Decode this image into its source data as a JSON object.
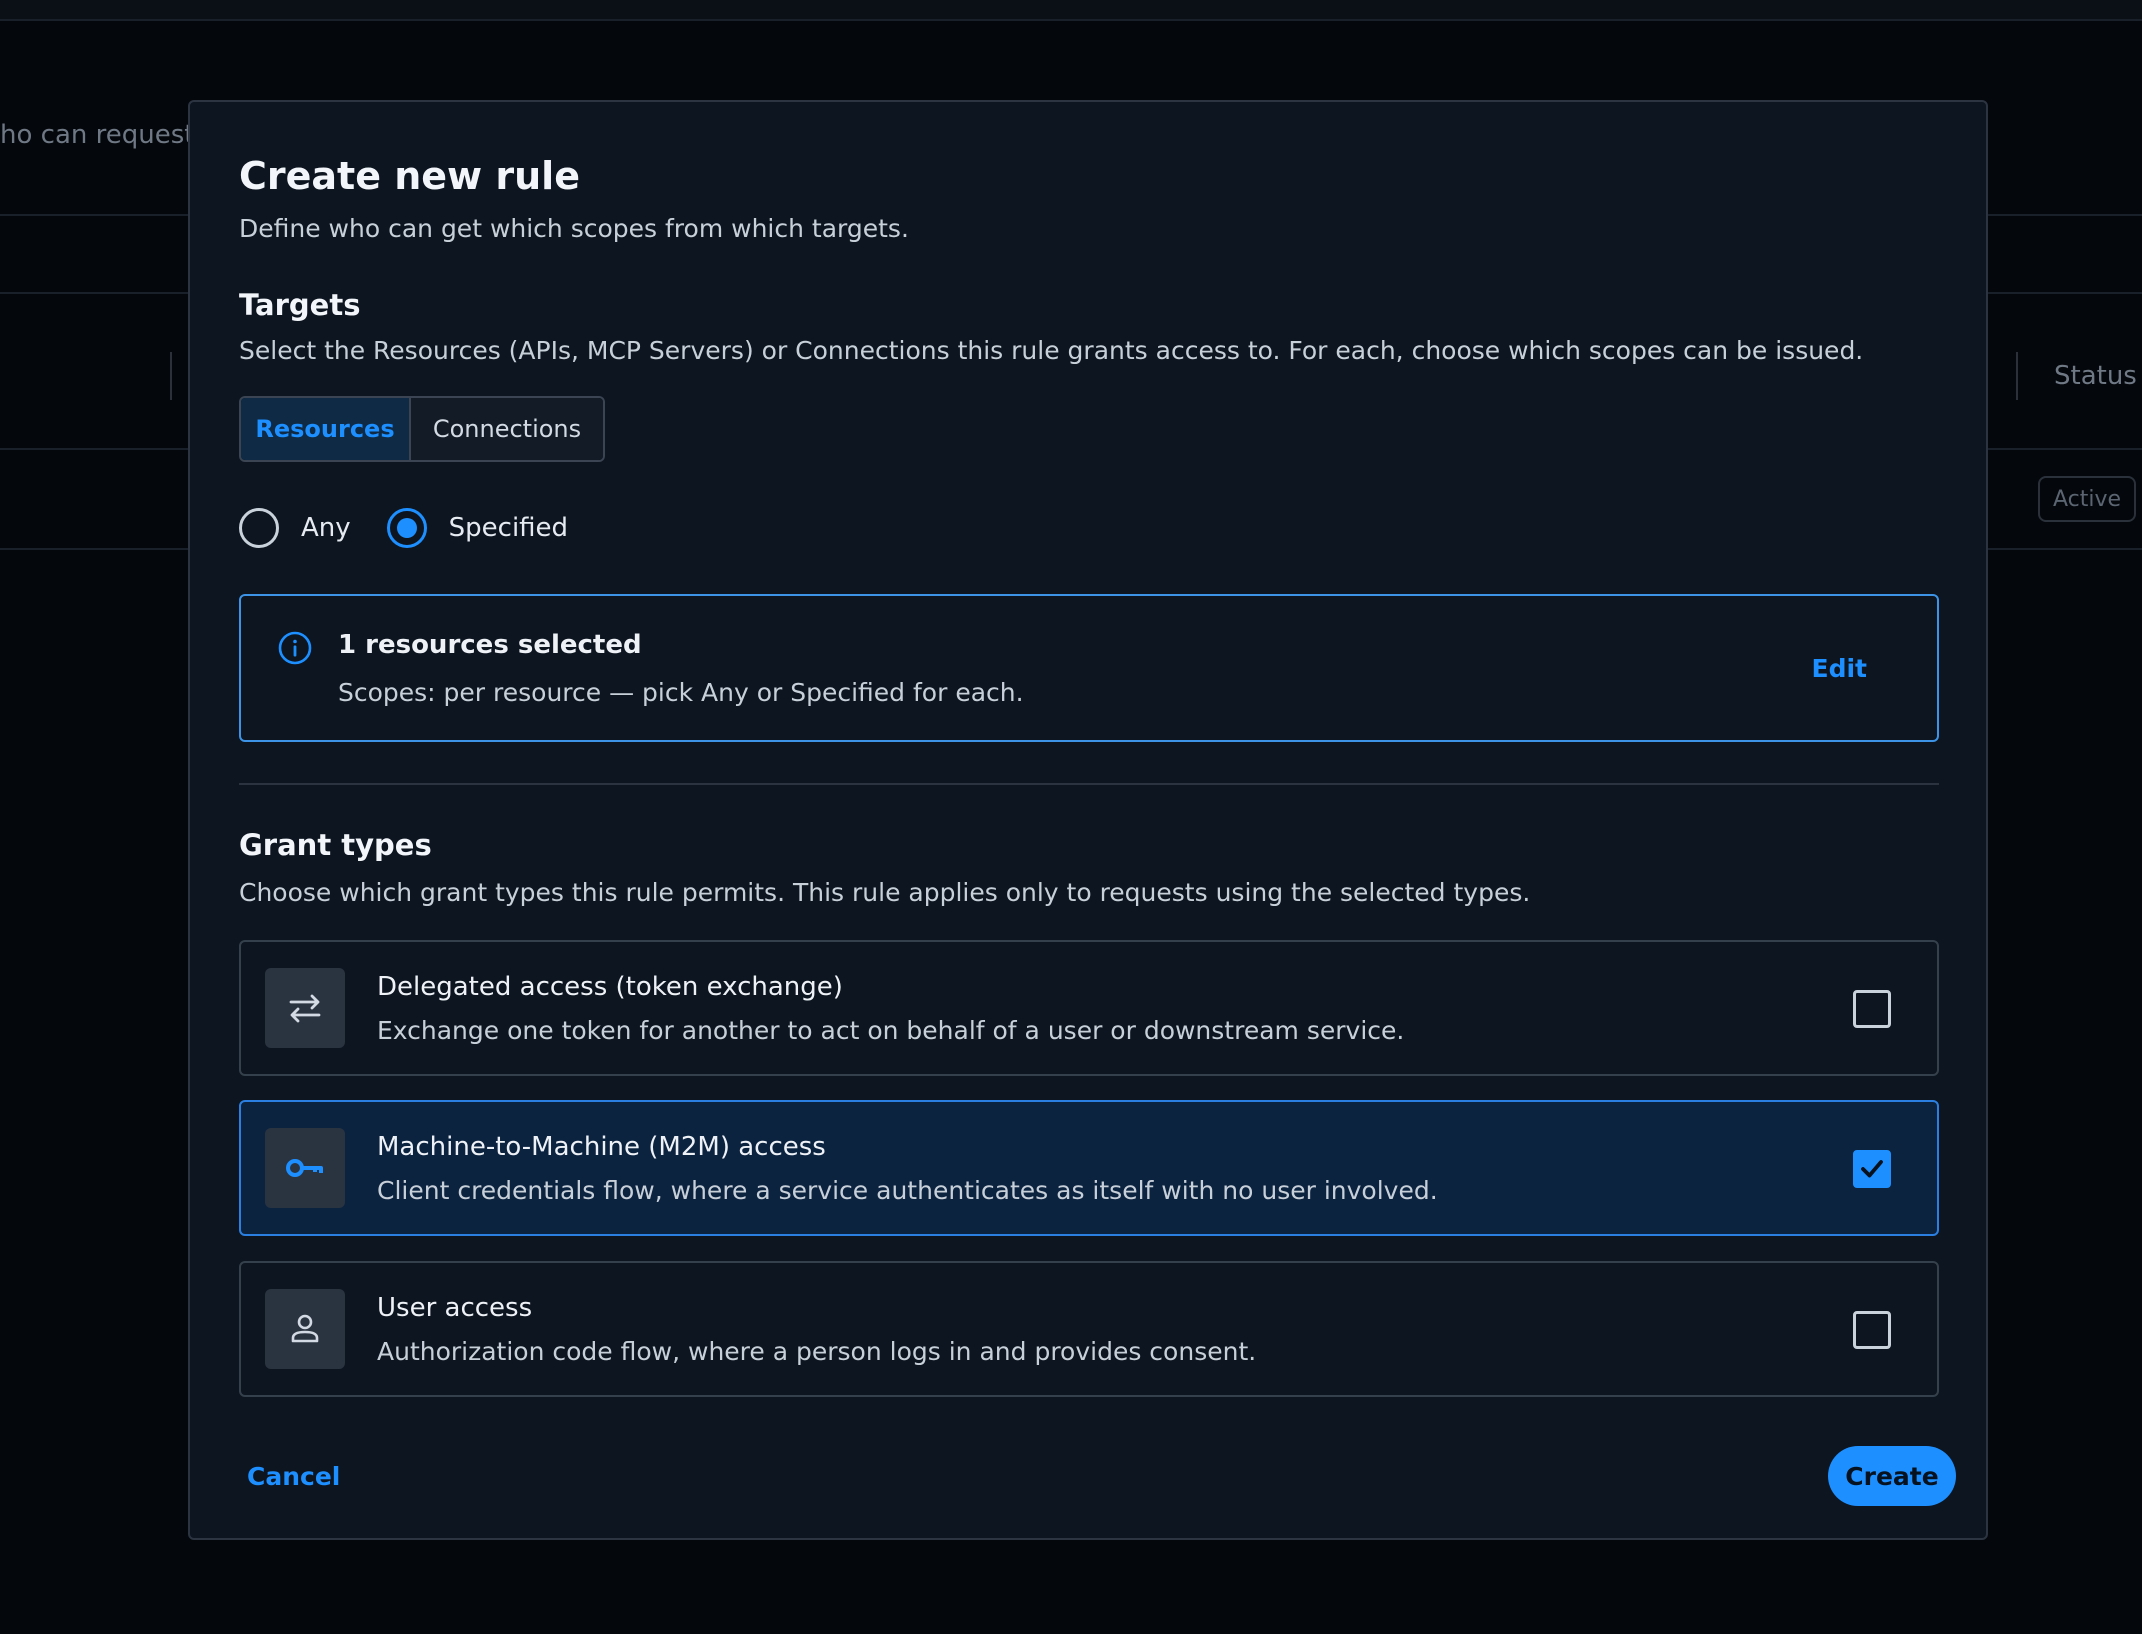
{
  "background": {
    "description_fragment": "ho can request a",
    "status_header": "Status",
    "status_badge": "Active"
  },
  "modal": {
    "title": "Create new rule",
    "subtitle": "Define who can get which scopes from which targets."
  },
  "targets": {
    "title": "Targets",
    "description": "Select the Resources (APIs, MCP Servers) or Connections this rule grants access to. For each, choose which scopes can be issued.",
    "tabs": [
      {
        "label": "Resources",
        "active": true
      },
      {
        "label": "Connections",
        "active": false
      }
    ],
    "radios": [
      {
        "label": "Any",
        "checked": false
      },
      {
        "label": "Specified",
        "checked": true
      }
    ],
    "info": {
      "icon": "info-icon",
      "title": "1 resources selected",
      "text": "Scopes: per resource — pick Any or Specified for each.",
      "edit_label": "Edit"
    }
  },
  "grant_types": {
    "title": "Grant types",
    "description": "Choose which grant types this rule permits. This rule applies only to requests using the selected types.",
    "items": [
      {
        "icon": "swap-arrows-icon",
        "title": "Delegated access (token exchange)",
        "text": "Exchange one token for another to act on behalf of a user or downstream service.",
        "checked": false
      },
      {
        "icon": "key-icon",
        "title": "Machine-to-Machine (M2M) access",
        "text": "Client credentials flow, where a service authenticates as itself with no user involved.",
        "checked": true
      },
      {
        "icon": "user-icon",
        "title": "User access",
        "text": "Authorization code flow, where a person logs in and provides consent.",
        "checked": false
      }
    ]
  },
  "footer": {
    "cancel_label": "Cancel",
    "create_label": "Create"
  },
  "colors": {
    "accent": "#1e8fff",
    "modal_bg": "#0d1520",
    "selected_card_bg": "#0c2340"
  }
}
